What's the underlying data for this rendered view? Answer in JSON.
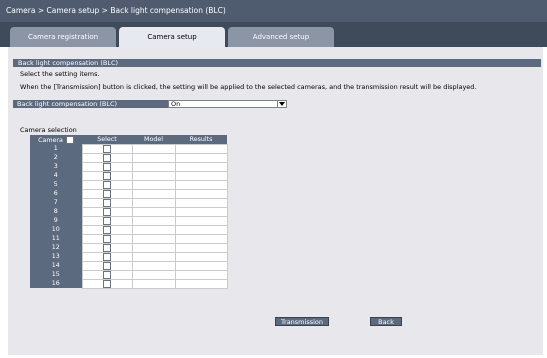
{
  "breadcrumb": "Camera > Camera setup > Back light compensation (BLC)",
  "tabs": [
    {
      "label": "Camera registration"
    },
    {
      "label": "Camera setup"
    },
    {
      "label": "Advanced setup"
    }
  ],
  "section": {
    "title": "Back light compensation (BLC)",
    "instruction1": "Select the setting items.",
    "instruction2": "When the [Transmission] button is clicked, the setting will be applied to the selected cameras, and the transmission result will be displayed."
  },
  "blc": {
    "label": "Back light compensation (BLC)",
    "value": "On"
  },
  "camera_selection": {
    "label": "Camera selection",
    "headers": {
      "camera": "Camera",
      "select": "Select",
      "model": "Model",
      "results": "Results"
    },
    "rows": [
      "1",
      "2",
      "3",
      "4",
      "5",
      "6",
      "7",
      "8",
      "9",
      "10",
      "11",
      "12",
      "13",
      "14",
      "15",
      "16"
    ]
  },
  "buttons": {
    "transmission": "Transmission",
    "back": "Back"
  },
  "colors": {
    "header_bar": "#4f5b6e",
    "cell_blue": "#5c6a80",
    "content_bg": "#e7e7ec"
  }
}
